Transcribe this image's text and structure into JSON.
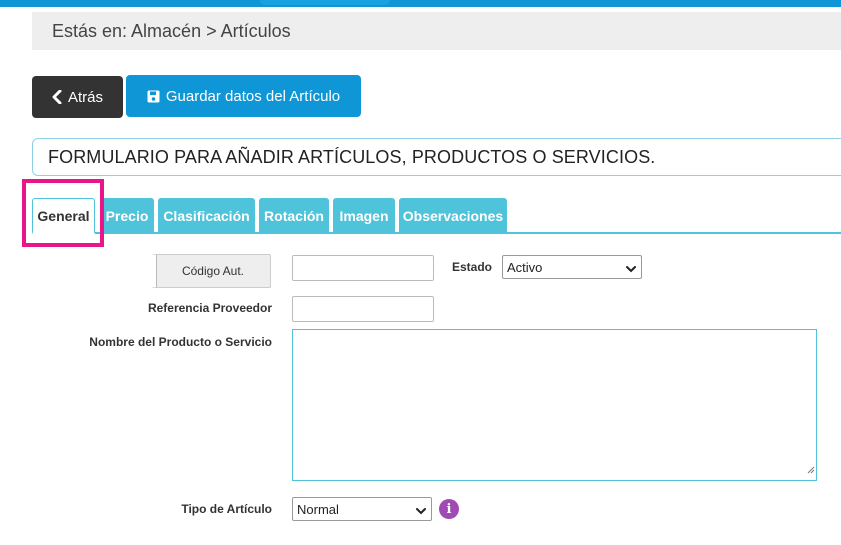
{
  "breadcrumb": {
    "text": "Estás en: Almacén > Artículos"
  },
  "toolbar": {
    "back_label": "Atrás",
    "save_label": "Guardar datos del Artículo"
  },
  "form": {
    "title": "FORMULARIO PARA AÑADIR ARTÍCULOS, PRODUCTOS O SERVICIOS."
  },
  "tabs": [
    {
      "label": "General",
      "active": true
    },
    {
      "label": "Precio"
    },
    {
      "label": "Clasificación"
    },
    {
      "label": "Rotación"
    },
    {
      "label": "Imagen"
    },
    {
      "label": "Observaciones"
    }
  ],
  "fields": {
    "codigo_button": "Código Aut.",
    "codigo_value": "",
    "estado_label": "Estado",
    "estado_value": "Activo",
    "referencia_label": "Referencia Proveedor",
    "referencia_value": "",
    "nombre_label": "Nombre del Producto o Servicio",
    "nombre_value": "",
    "tipo_label": "Tipo de Artículo",
    "tipo_value": "Normal",
    "info_glyph": "i"
  },
  "colors": {
    "accent": "#0f96d6",
    "tab": "#4fc3d9",
    "highlight": "#e8168a",
    "info": "#a04bb5",
    "dark_button": "#333333"
  },
  "icons": {
    "back": "chevron-left-icon",
    "save": "floppy-disk-icon",
    "info": "info-icon"
  }
}
